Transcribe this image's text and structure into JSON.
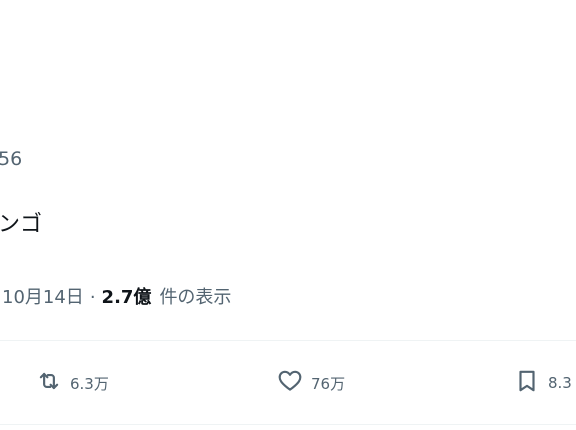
{
  "tweet": {
    "handle_fragment": "56",
    "text_fragment": "ンゴ",
    "date": "10月14日",
    "separator": "·",
    "views_count": "2.7億",
    "views_label": "件の表示"
  },
  "actions": {
    "retweet": {
      "icon": "retweet-icon",
      "count": "6.3万"
    },
    "like": {
      "icon": "heart-icon",
      "count": "76万"
    },
    "bookmark": {
      "icon": "bookmark-icon",
      "count": "8.3"
    }
  },
  "colors": {
    "primary_text": "#0f1419",
    "secondary_text": "#536471",
    "divider": "#eff3f4"
  }
}
